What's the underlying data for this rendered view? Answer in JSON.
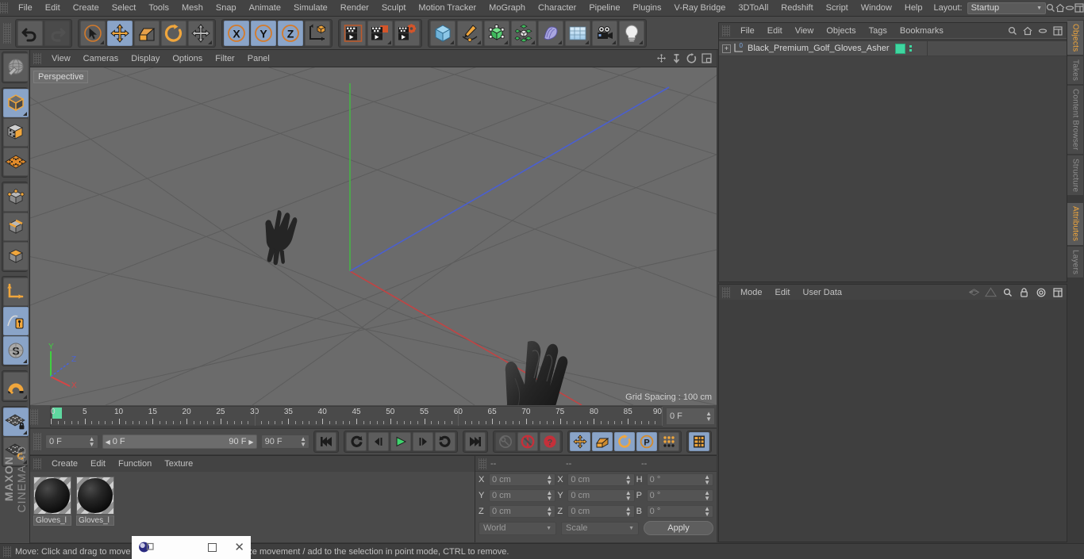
{
  "menubar": {
    "items": [
      "File",
      "Edit",
      "Create",
      "Select",
      "Tools",
      "Mesh",
      "Snap",
      "Animate",
      "Simulate",
      "Render",
      "Sculpt",
      "Motion Tracker",
      "MoGraph",
      "Character",
      "Pipeline",
      "Plugins",
      "V-Ray Bridge",
      "3DToAll",
      "Redshift",
      "Script",
      "Window",
      "Help"
    ],
    "layout_label": "Layout:",
    "layout_value": "Startup",
    "search_icon": "search-icon",
    "home_icon": "home-icon",
    "minimize_icon": "minimize-icon",
    "maximize_icon": "maximize-icon"
  },
  "toolbar": {
    "undo": "undo-icon",
    "redo": "redo-icon",
    "select": "live-selection-icon",
    "move": "move-tool-icon",
    "scale": "scale-tool-icon",
    "rotate": "rotate-tool-icon",
    "move2": "move-axis-icon",
    "axis_x": "X",
    "axis_y": "Y",
    "axis_z": "Z",
    "world_axis": "world-object-axis-icon",
    "render_view": "render-view-icon",
    "render_region": "render-region-icon",
    "render_settings": "render-settings-icon",
    "cube": "add-cube-object-icon",
    "spline": "add-spline-icon",
    "nurbs": "add-generator-icon",
    "array": "add-modeling-object-icon",
    "deformer": "add-deformer-icon",
    "scene": "add-scene-object-icon",
    "camera": "add-camera-icon",
    "light": "add-light-icon"
  },
  "lefttools": {
    "items": [
      {
        "name": "make-editable-icon",
        "on": false
      },
      {
        "name": "model-mode-icon",
        "on": true
      },
      {
        "name": "texture-mode-icon",
        "on": false
      },
      {
        "name": "workplane-icon",
        "on": false
      },
      {
        "name": "points-mode-icon",
        "on": false
      },
      {
        "name": "edges-mode-icon",
        "on": false
      },
      {
        "name": "polygons-mode-icon",
        "on": false
      },
      {
        "name": "object-axis-icon",
        "on": false
      },
      {
        "name": "enable-snap-icon",
        "on": true
      },
      {
        "name": "snap-settings-icon",
        "on": true
      },
      {
        "name": "magnet-icon",
        "on": false
      },
      {
        "name": "workplane-lock-icon",
        "on": true
      },
      {
        "name": "planar-workplane-icon",
        "on": false
      }
    ],
    "brand_bold": "MAXON",
    "brand_light": "CINEMA 4D"
  },
  "viewport": {
    "menu": [
      "View",
      "Cameras",
      "Display",
      "Options",
      "Filter",
      "Panel"
    ],
    "perspective_label": "Perspective",
    "grid_spacing": "Grid Spacing : 100 cm",
    "axis_x": "X",
    "axis_y": "Y",
    "axis_z": "Z",
    "nav_icons": [
      "pan-icon",
      "dolly-icon",
      "rotate-icon",
      "maximize-viewport-icon"
    ]
  },
  "timeline": {
    "ticks": [
      0,
      5,
      10,
      15,
      20,
      25,
      30,
      35,
      40,
      45,
      50,
      55,
      60,
      65,
      70,
      75,
      80,
      85,
      90
    ],
    "current_frame_field": "0 F"
  },
  "transport": {
    "current_frame": "0 F",
    "range_start": "0 F",
    "range_end": "90 F",
    "max_frame": "90 F",
    "buttons": [
      {
        "name": "go-to-start-button",
        "glyph": "start"
      },
      {
        "name": "go-to-previous-key-button",
        "glyph": "prevkey"
      },
      {
        "name": "step-back-button",
        "glyph": "stepback"
      },
      {
        "name": "play-button",
        "glyph": "play"
      },
      {
        "name": "step-forward-button",
        "glyph": "stepfwd"
      },
      {
        "name": "go-to-next-key-button",
        "glyph": "nextkey"
      },
      {
        "name": "go-to-end-button",
        "glyph": "end"
      }
    ],
    "record_keyframe": "record-keyframe-icon",
    "autokey": "autokeying-icon",
    "keyframe_help": "keyframe-selection-icon",
    "pos_key": "position-key-icon",
    "scale_key": "scale-key-icon",
    "rot_key": "rotation-key-icon",
    "param_key": "parameter-key-icon",
    "pla_key": "point-level-animation-icon",
    "timeline_toggle": "timeline-icon"
  },
  "material_manager": {
    "menu": [
      "Create",
      "Edit",
      "Function",
      "Texture"
    ],
    "materials": [
      {
        "name": "Gloves_l"
      },
      {
        "name": "Gloves_l"
      }
    ]
  },
  "coordinates": {
    "header_dashes": [
      "--",
      "--",
      "--"
    ],
    "rows": [
      {
        "pos_label": "X",
        "pos_value": "0 cm",
        "size_label": "X",
        "size_value": "0 cm",
        "rot_label": "H",
        "rot_value": "0 °"
      },
      {
        "pos_label": "Y",
        "pos_value": "0 cm",
        "size_label": "Y",
        "size_value": "0 cm",
        "rot_label": "P",
        "rot_value": "0 °"
      },
      {
        "pos_label": "Z",
        "pos_value": "0 cm",
        "size_label": "Z",
        "size_value": "0 cm",
        "rot_label": "B",
        "rot_value": "0 °"
      }
    ],
    "system": "World",
    "mode": "Scale",
    "apply": "Apply"
  },
  "object_manager": {
    "menu": [
      "File",
      "Edit",
      "View",
      "Objects",
      "Tags",
      "Bookmarks"
    ],
    "icons": [
      "search-icon",
      "home-icon",
      "minimize-icon",
      "maximize-icon"
    ],
    "objects": [
      {
        "name": "Black_Premium_Golf_Gloves_Asher",
        "layer": "0",
        "tag_color": "#3fd6a0"
      }
    ]
  },
  "attributes": {
    "menu": [
      "Mode",
      "Edit",
      "User Data"
    ],
    "icons": [
      "history-back-icon",
      "history-forward-icon",
      "search-icon",
      "lock-icon",
      "pin-icon",
      "maximize-icon"
    ]
  },
  "vtabs_top": [
    "Objects",
    "Takes",
    "Content Browser",
    "Structure"
  ],
  "vtabs_bottom": [
    "Attributes",
    "Layers"
  ],
  "statusbar": {
    "text": "Move: Click and drag to move the selection. SHIFT to quantize movement / add to the selection in point mode, CTRL to remove."
  },
  "overlay": {
    "app_icon": "cinema4d-icon",
    "restore_icon": "restore-window-icon",
    "maximize_icon": "maximize-window-icon",
    "close_icon": "close-window-icon"
  },
  "colors": {
    "accent_orange": "#f0a63c",
    "selected_blue": "#8aa4c8",
    "tag_green": "#3fd6a0",
    "axis_x": "#d14545",
    "axis_y": "#45d145",
    "axis_z": "#4560d1"
  }
}
